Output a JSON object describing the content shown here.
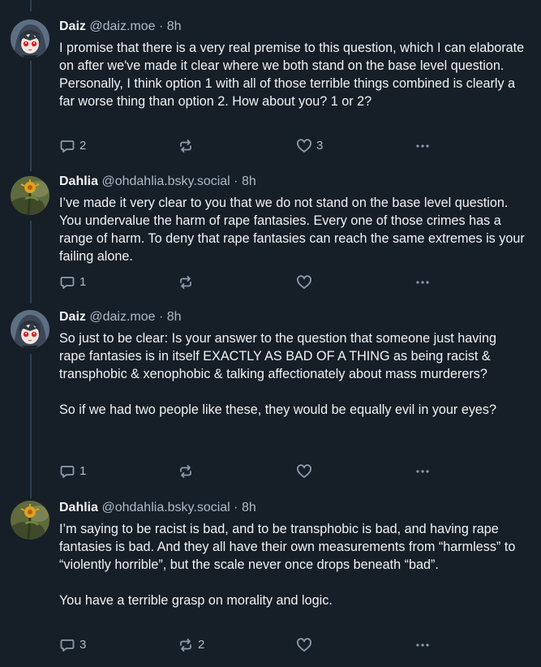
{
  "posts": [
    {
      "author": "Daiz",
      "handle": "@daiz.moe",
      "separator": "·",
      "time": "8h",
      "paragraphs": [
        "I promise that there is a very real premise to this question, which I can elaborate on after we've made it clear where we both stand on the base level question. Personally, I think option 1 with all of those terrible things combined is clearly a far worse thing than option 2. How about you? 1 or 2?"
      ],
      "replies": "2",
      "reposts": "",
      "likes": "3"
    },
    {
      "author": "Dahlia",
      "handle": "@ohdahlia.bsky.social",
      "separator": "·",
      "time": "8h",
      "paragraphs": [
        "I’ve made it very clear to you that we do not stand on the base level question. You undervalue the harm of rape fantasies. Every one of those crimes has a range of harm. To deny that rape fantasies can reach the same extremes is your failing alone."
      ],
      "replies": "1",
      "reposts": "",
      "likes": ""
    },
    {
      "author": "Daiz",
      "handle": "@daiz.moe",
      "separator": "·",
      "time": "8h",
      "paragraphs": [
        "So just to be clear: Is your answer to the question that someone just having rape fantasies is in itself EXACTLY AS BAD OF A THING as being racist & transphobic & xenophobic & talking affectionately about mass murderers?",
        "So if we had two people like these, they would be equally evil in your eyes?"
      ],
      "replies": "1",
      "reposts": "",
      "likes": ""
    },
    {
      "author": "Dahlia",
      "handle": "@ohdahlia.bsky.social",
      "separator": "·",
      "time": "8h",
      "paragraphs": [
        "I’m saying to be racist is bad, and to be transphobic is bad, and having rape fantasies is bad. And they all have their own measurements from “harmless” to “violently horrible”, but the scale never once drops beneath “bad”.",
        "You have a terrible grasp on morality and logic."
      ],
      "replies": "3",
      "reposts": "2",
      "likes": ""
    }
  ],
  "icons": {
    "reply": "speech-bubble-icon",
    "repost": "repost-arrows-icon",
    "like": "heart-icon",
    "more": "ellipsis-icon"
  },
  "colors": {
    "background": "#161e27",
    "text": "#f1f3f5",
    "muted": "#aebbc9",
    "icon": "#8d9cae",
    "thread_line": "#2e4052"
  }
}
